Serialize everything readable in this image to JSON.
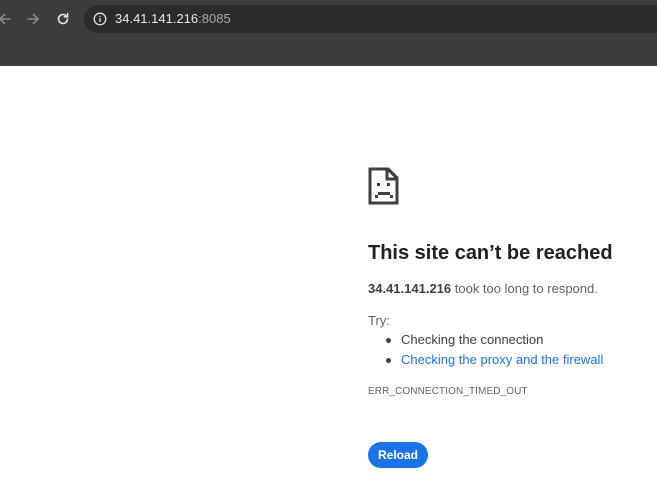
{
  "browser": {
    "url_host": "34.41.141.216",
    "url_port": ":8085",
    "icons": {
      "back": "arrow-left-icon",
      "forward": "arrow-right-icon",
      "reload": "reload-icon",
      "site_info": "info-icon"
    }
  },
  "error_page": {
    "icon": "sad-page-icon",
    "title": "This site can’t be reached",
    "host": "34.41.141.216",
    "description_suffix": " took too long to respond.",
    "try_label": "Try:",
    "suggestions": [
      "Checking the connection",
      "Checking the proxy and the firewall"
    ],
    "error_code": "ERR_CONNECTION_TIMED_OUT",
    "reload_label": "Reload"
  },
  "colors": {
    "chrome_bg": "#3c3c3c",
    "omnibox_bg": "#2b2b2b",
    "link": "#1a73e8",
    "button": "#1a73e8"
  }
}
